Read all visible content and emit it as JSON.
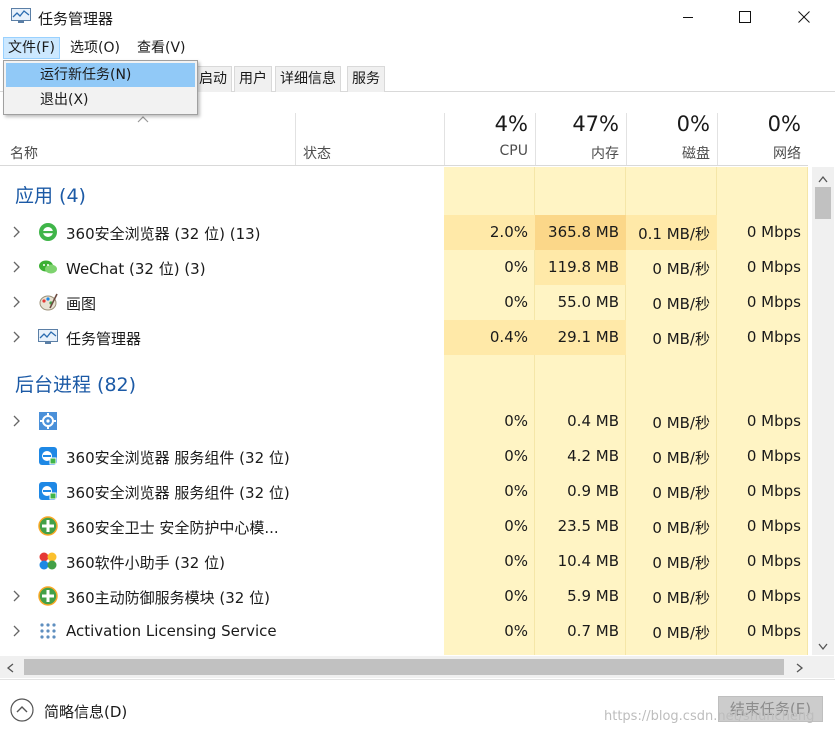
{
  "window": {
    "title": "任务管理器"
  },
  "menu": {
    "file": "文件(F)",
    "options": "选项(O)",
    "view": "查看(V)"
  },
  "file_menu": {
    "run_new_task": "运行新任务(N)",
    "exit": "退出(X)"
  },
  "tabs": [
    "启动",
    "用户",
    "详细信息",
    "服务"
  ],
  "columns": {
    "name": "名称",
    "status": "状态",
    "cpu": {
      "pct": "4%",
      "label": "CPU"
    },
    "memory": {
      "pct": "47%",
      "label": "内存"
    },
    "disk": {
      "pct": "0%",
      "label": "磁盘"
    },
    "network": {
      "pct": "0%",
      "label": "网络"
    }
  },
  "groups": {
    "apps": "应用 (4)",
    "background": "后台进程 (82)"
  },
  "apps": [
    {
      "name": "360安全浏览器 (32 位) (13)",
      "cpu": "2.0%",
      "mem": "365.8 MB",
      "disk": "0.1 MB/秒",
      "net": "0 Mbps",
      "icon": "ie-green-icon"
    },
    {
      "name": "WeChat (32 位) (3)",
      "cpu": "0%",
      "mem": "119.8 MB",
      "disk": "0 MB/秒",
      "net": "0 Mbps",
      "icon": "wechat-icon"
    },
    {
      "name": "画图",
      "cpu": "0%",
      "mem": "55.0 MB",
      "disk": "0 MB/秒",
      "net": "0 Mbps",
      "icon": "paint-icon"
    },
    {
      "name": "任务管理器",
      "cpu": "0.4%",
      "mem": "29.1 MB",
      "disk": "0 MB/秒",
      "net": "0 Mbps",
      "icon": "task-manager-icon"
    }
  ],
  "background": [
    {
      "name": "",
      "cpu": "0%",
      "mem": "0.4 MB",
      "disk": "0 MB/秒",
      "net": "0 Mbps",
      "icon": "gear-icon"
    },
    {
      "name": "360安全浏览器 服务组件 (32 位)",
      "cpu": "0%",
      "mem": "4.2 MB",
      "disk": "0 MB/秒",
      "net": "0 Mbps",
      "icon": "360-browser-service-icon"
    },
    {
      "name": "360安全浏览器 服务组件 (32 位)",
      "cpu": "0%",
      "mem": "0.9 MB",
      "disk": "0 MB/秒",
      "net": "0 Mbps",
      "icon": "360-browser-service-icon"
    },
    {
      "name": "360安全卫士 安全防护中心模...",
      "cpu": "0%",
      "mem": "23.5 MB",
      "disk": "0 MB/秒",
      "net": "0 Mbps",
      "icon": "360-safeguard-icon"
    },
    {
      "name": "360软件小助手 (32 位)",
      "cpu": "0%",
      "mem": "10.4 MB",
      "disk": "0 MB/秒",
      "net": "0 Mbps",
      "icon": "360-software-helper-icon"
    },
    {
      "name": "360主动防御服务模块 (32 位)",
      "cpu": "0%",
      "mem": "5.9 MB",
      "disk": "0 MB/秒",
      "net": "0 Mbps",
      "icon": "360-safeguard-icon"
    },
    {
      "name": "Activation Licensing Service",
      "cpu": "0%",
      "mem": "0.7 MB",
      "disk": "0 MB/秒",
      "net": "0 Mbps",
      "icon": "dots-icon"
    }
  ],
  "footer": {
    "fewer_details": "简略信息(D)",
    "end_task": "结束任务(E)",
    "watermark": "https://blog.csdn.net/shuncheng"
  },
  "colors": {
    "accent_blue": "#1c5aa6",
    "heat_light": "#fff4c4",
    "heat_medium": "#ffe9a8",
    "heat_high": "#fbd789"
  }
}
